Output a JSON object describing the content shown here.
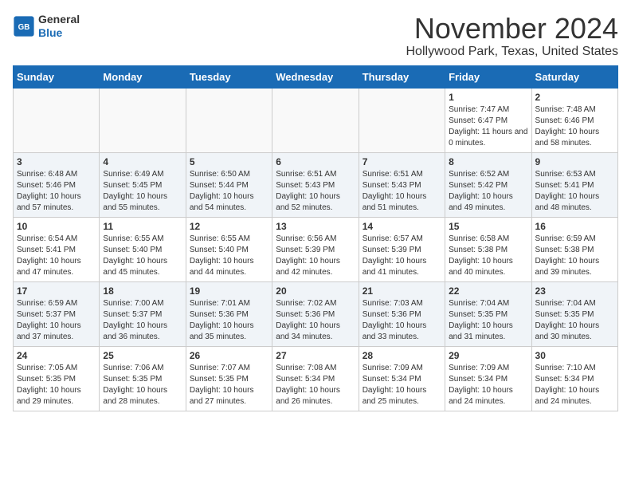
{
  "logo": {
    "general": "General",
    "blue": "Blue"
  },
  "title": "November 2024",
  "location": "Hollywood Park, Texas, United States",
  "days_of_week": [
    "Sunday",
    "Monday",
    "Tuesday",
    "Wednesday",
    "Thursday",
    "Friday",
    "Saturday"
  ],
  "weeks": [
    [
      {
        "day": "",
        "info": ""
      },
      {
        "day": "",
        "info": ""
      },
      {
        "day": "",
        "info": ""
      },
      {
        "day": "",
        "info": ""
      },
      {
        "day": "",
        "info": ""
      },
      {
        "day": "1",
        "info": "Sunrise: 7:47 AM\nSunset: 6:47 PM\nDaylight: 11 hours and 0 minutes."
      },
      {
        "day": "2",
        "info": "Sunrise: 7:48 AM\nSunset: 6:46 PM\nDaylight: 10 hours and 58 minutes."
      }
    ],
    [
      {
        "day": "3",
        "info": "Sunrise: 6:48 AM\nSunset: 5:46 PM\nDaylight: 10 hours and 57 minutes."
      },
      {
        "day": "4",
        "info": "Sunrise: 6:49 AM\nSunset: 5:45 PM\nDaylight: 10 hours and 55 minutes."
      },
      {
        "day": "5",
        "info": "Sunrise: 6:50 AM\nSunset: 5:44 PM\nDaylight: 10 hours and 54 minutes."
      },
      {
        "day": "6",
        "info": "Sunrise: 6:51 AM\nSunset: 5:43 PM\nDaylight: 10 hours and 52 minutes."
      },
      {
        "day": "7",
        "info": "Sunrise: 6:51 AM\nSunset: 5:43 PM\nDaylight: 10 hours and 51 minutes."
      },
      {
        "day": "8",
        "info": "Sunrise: 6:52 AM\nSunset: 5:42 PM\nDaylight: 10 hours and 49 minutes."
      },
      {
        "day": "9",
        "info": "Sunrise: 6:53 AM\nSunset: 5:41 PM\nDaylight: 10 hours and 48 minutes."
      }
    ],
    [
      {
        "day": "10",
        "info": "Sunrise: 6:54 AM\nSunset: 5:41 PM\nDaylight: 10 hours and 47 minutes."
      },
      {
        "day": "11",
        "info": "Sunrise: 6:55 AM\nSunset: 5:40 PM\nDaylight: 10 hours and 45 minutes."
      },
      {
        "day": "12",
        "info": "Sunrise: 6:55 AM\nSunset: 5:40 PM\nDaylight: 10 hours and 44 minutes."
      },
      {
        "day": "13",
        "info": "Sunrise: 6:56 AM\nSunset: 5:39 PM\nDaylight: 10 hours and 42 minutes."
      },
      {
        "day": "14",
        "info": "Sunrise: 6:57 AM\nSunset: 5:39 PM\nDaylight: 10 hours and 41 minutes."
      },
      {
        "day": "15",
        "info": "Sunrise: 6:58 AM\nSunset: 5:38 PM\nDaylight: 10 hours and 40 minutes."
      },
      {
        "day": "16",
        "info": "Sunrise: 6:59 AM\nSunset: 5:38 PM\nDaylight: 10 hours and 39 minutes."
      }
    ],
    [
      {
        "day": "17",
        "info": "Sunrise: 6:59 AM\nSunset: 5:37 PM\nDaylight: 10 hours and 37 minutes."
      },
      {
        "day": "18",
        "info": "Sunrise: 7:00 AM\nSunset: 5:37 PM\nDaylight: 10 hours and 36 minutes."
      },
      {
        "day": "19",
        "info": "Sunrise: 7:01 AM\nSunset: 5:36 PM\nDaylight: 10 hours and 35 minutes."
      },
      {
        "day": "20",
        "info": "Sunrise: 7:02 AM\nSunset: 5:36 PM\nDaylight: 10 hours and 34 minutes."
      },
      {
        "day": "21",
        "info": "Sunrise: 7:03 AM\nSunset: 5:36 PM\nDaylight: 10 hours and 33 minutes."
      },
      {
        "day": "22",
        "info": "Sunrise: 7:04 AM\nSunset: 5:35 PM\nDaylight: 10 hours and 31 minutes."
      },
      {
        "day": "23",
        "info": "Sunrise: 7:04 AM\nSunset: 5:35 PM\nDaylight: 10 hours and 30 minutes."
      }
    ],
    [
      {
        "day": "24",
        "info": "Sunrise: 7:05 AM\nSunset: 5:35 PM\nDaylight: 10 hours and 29 minutes."
      },
      {
        "day": "25",
        "info": "Sunrise: 7:06 AM\nSunset: 5:35 PM\nDaylight: 10 hours and 28 minutes."
      },
      {
        "day": "26",
        "info": "Sunrise: 7:07 AM\nSunset: 5:35 PM\nDaylight: 10 hours and 27 minutes."
      },
      {
        "day": "27",
        "info": "Sunrise: 7:08 AM\nSunset: 5:34 PM\nDaylight: 10 hours and 26 minutes."
      },
      {
        "day": "28",
        "info": "Sunrise: 7:09 AM\nSunset: 5:34 PM\nDaylight: 10 hours and 25 minutes."
      },
      {
        "day": "29",
        "info": "Sunrise: 7:09 AM\nSunset: 5:34 PM\nDaylight: 10 hours and 24 minutes."
      },
      {
        "day": "30",
        "info": "Sunrise: 7:10 AM\nSunset: 5:34 PM\nDaylight: 10 hours and 24 minutes."
      }
    ]
  ]
}
